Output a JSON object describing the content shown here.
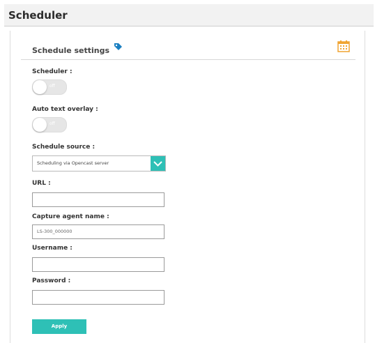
{
  "page": {
    "title": "Scheduler"
  },
  "panel": {
    "title": "Schedule settings"
  },
  "icons": {
    "tag": "tag-icon",
    "calendar": "calendar-icon"
  },
  "colors": {
    "accent": "#2ec0b6",
    "calendar": "#f0a431",
    "tag": "#1a7fc1"
  },
  "fields": {
    "scheduler": {
      "label": "Scheduler :",
      "toggle_text": "off"
    },
    "auto_text": {
      "label": "Auto text overlay :",
      "toggle_text": "off"
    },
    "schedule_source": {
      "label": "Schedule source :",
      "value": "Scheduling via Opencast server"
    },
    "url": {
      "label": "URL :",
      "value": ""
    },
    "capture_agent": {
      "label": "Capture agent name :",
      "value": "LS-300_000000"
    },
    "username": {
      "label": "Username :",
      "value": ""
    },
    "password": {
      "label": "Password :",
      "value": ""
    }
  },
  "actions": {
    "apply_label": "Apply"
  }
}
